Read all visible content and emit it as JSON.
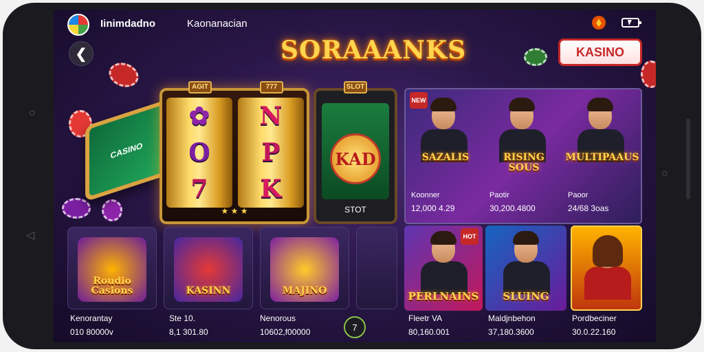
{
  "app": {
    "name": "Iinimdadno",
    "subtitle": "Kaonanacian",
    "brand_title": "SORAAANKS",
    "cta_label": "KASINO"
  },
  "nav": {
    "back_icon": "chevron-left-icon",
    "back_glyph": "❮"
  },
  "hero": {
    "table_label": "CASINO",
    "slot_machine": {
      "top_labels": [
        "AGIT",
        "777"
      ],
      "reel_left": [
        "✿",
        "O",
        "7"
      ],
      "reel_right": [
        "N",
        "P",
        "K"
      ],
      "stars": "★ ★ ★"
    },
    "slot_card": {
      "top_label": "SLOT",
      "badge": "KAD",
      "label": "STOT"
    }
  },
  "featured": [
    {
      "title": "SAZALIS",
      "caption": "Koonner",
      "value": "12,000 4.29",
      "badge": "NEW"
    },
    {
      "title": "RISING SOUS",
      "caption": "Paotir",
      "value": "30,200.4800",
      "badge": ""
    },
    {
      "title": "MULTIPAAUS",
      "caption": "Paoor",
      "value": "24/68 3oas",
      "badge": ""
    }
  ],
  "bottom_row": [
    {
      "art_title": "Roudio Casions",
      "caption": "Kenorantay",
      "value": "010 80000v"
    },
    {
      "art_title": "KASINN",
      "caption": "Ste 10.",
      "value": "8,1 301.80"
    },
    {
      "art_title": "MAJINO",
      "caption": "Nenorous",
      "value": "10602,f00000"
    }
  ],
  "center_button_glyph": "7",
  "game_cards": [
    {
      "title": "PERLNAINS",
      "caption": "Fleetr VA",
      "value": "80,160.001",
      "badge": "HOT"
    },
    {
      "title": "SLUING",
      "caption": "Maldjnbehon",
      "value": "37,180.3600",
      "badge": ""
    },
    {
      "title": "",
      "caption": "Pordbeciner",
      "value": "30.0.22.160",
      "badge": ""
    }
  ]
}
